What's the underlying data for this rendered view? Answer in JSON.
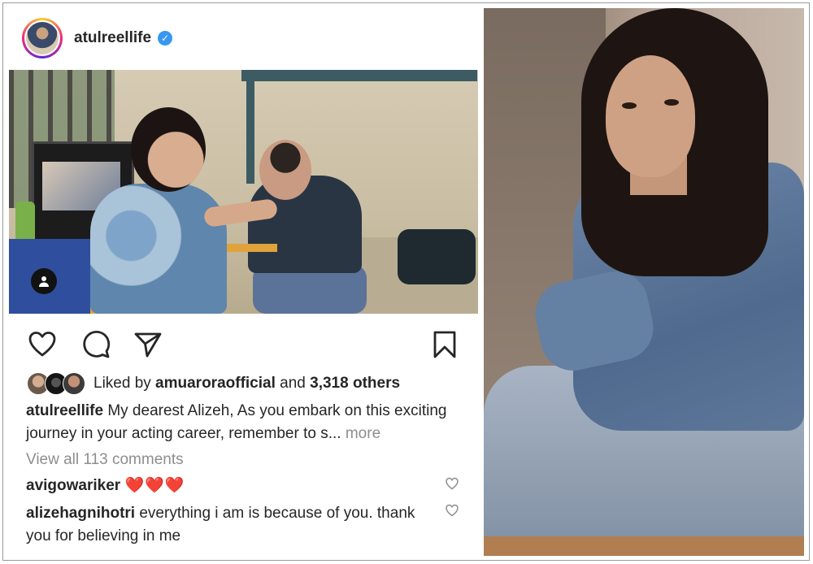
{
  "post": {
    "author": "atulreellife",
    "verified_icon": "verified-badge-icon",
    "likes": {
      "prefix": "Liked by ",
      "user": "amuaroraofficial",
      "middle": " and ",
      "count": "3,318 others"
    },
    "caption": {
      "author": "atulreellife",
      "text": "My dearest Alizeh, As you embark on this exciting journey in your acting career, remember to s...",
      "more": " more"
    },
    "view_all": "View all 113 comments",
    "comments": [
      {
        "user": "avigowariker",
        "text": "❤️❤️❤️"
      },
      {
        "user": "alizehagnihotri",
        "text": "everything i am is because of you. thank you for believing in me"
      }
    ],
    "icons": {
      "like": "heart-icon",
      "comment": "comment-icon",
      "share": "send-icon",
      "save": "bookmark-icon",
      "tag": "user-tag-icon"
    }
  },
  "colors": {
    "text": "#262626",
    "muted": "#8e8e8e",
    "verified": "#3897f0",
    "heart": "#e0242f"
  }
}
